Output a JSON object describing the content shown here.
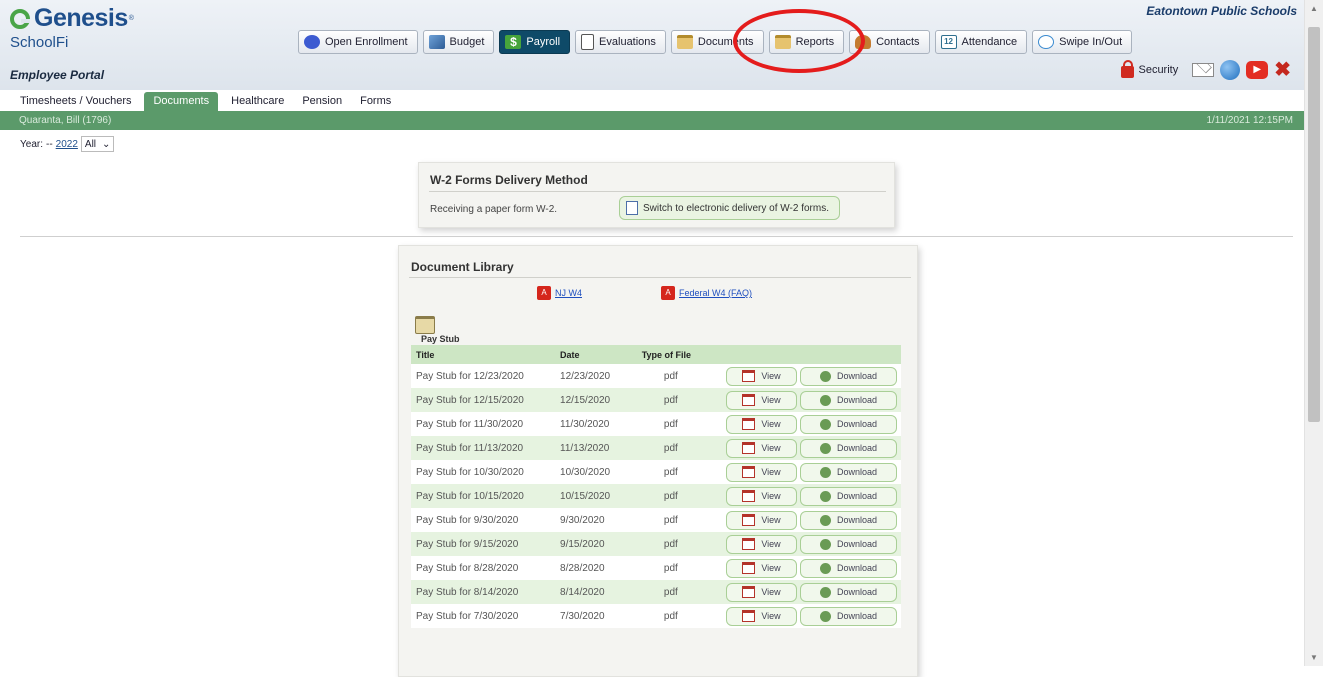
{
  "header": {
    "logo_word": "Genesis",
    "logo_reg": "®",
    "logo_sub": "SchoolFi",
    "portal_label": "Employee Portal",
    "school_name": "Eatontown Public Schools",
    "nav": [
      {
        "label": "Open Enrollment",
        "icon": "enrollment-icon"
      },
      {
        "label": "Budget",
        "icon": "budget-icon"
      },
      {
        "label": "Payroll",
        "icon": "payroll-icon",
        "active": true,
        "icon_glyph": "$"
      },
      {
        "label": "Evaluations",
        "icon": "evaluations-icon"
      },
      {
        "label": "Documents",
        "icon": "documents-folder-icon",
        "highlighted": true
      },
      {
        "label": "Reports",
        "icon": "reports-folder-icon"
      },
      {
        "label": "Contacts",
        "icon": "contacts-icon"
      },
      {
        "label": "Attendance",
        "icon": "attendance-calendar-icon",
        "icon_glyph": "12"
      },
      {
        "label": "Swipe In/Out",
        "icon": "swipe-clock-icon"
      }
    ],
    "utility": {
      "security_label": "Security",
      "icons": [
        "lock-icon",
        "mail-icon",
        "help-globe-icon",
        "video-icon",
        "close-icon"
      ]
    },
    "highlight_color": "#e41c1c"
  },
  "tabs": [
    {
      "label": "Timesheets / Vouchers"
    },
    {
      "label": "Documents",
      "active": true
    },
    {
      "label": "Healthcare"
    },
    {
      "label": "Pension"
    },
    {
      "label": "Forms"
    }
  ],
  "statusbar": {
    "employee": "Quaranta, Bill (1796)",
    "timestamp": "1/11/2021 12:15PM"
  },
  "filter": {
    "year_label": "Year:",
    "year_prefix": "--",
    "year_value": "2022",
    "select_value": "All",
    "select_arrow": "⌄"
  },
  "w2": {
    "title": "W-2 Forms Delivery Method",
    "status_text": "Receiving a paper form W-2.",
    "switch_button": "Switch to electronic delivery of W-2 forms."
  },
  "library": {
    "title": "Document Library",
    "links": [
      {
        "label": "NJ W4",
        "icon_glyph": "A"
      },
      {
        "label": "Federal W4 (FAQ)",
        "icon_glyph": "A"
      }
    ],
    "section_label": "Pay Stub",
    "columns": [
      "Title",
      "Date",
      "Type of File",
      ""
    ],
    "view_label": "View",
    "download_label": "Download",
    "rows": [
      {
        "title": "Pay Stub for 12/23/2020",
        "date": "12/23/2020",
        "type": "pdf"
      },
      {
        "title": "Pay Stub for 12/15/2020",
        "date": "12/15/2020",
        "type": "pdf"
      },
      {
        "title": "Pay Stub for 11/30/2020",
        "date": "11/30/2020",
        "type": "pdf"
      },
      {
        "title": "Pay Stub for 11/13/2020",
        "date": "11/13/2020",
        "type": "pdf"
      },
      {
        "title": "Pay Stub for 10/30/2020",
        "date": "10/30/2020",
        "type": "pdf"
      },
      {
        "title": "Pay Stub for 10/15/2020",
        "date": "10/15/2020",
        "type": "pdf"
      },
      {
        "title": "Pay Stub for 9/30/2020",
        "date": "9/30/2020",
        "type": "pdf"
      },
      {
        "title": "Pay Stub for 9/15/2020",
        "date": "9/15/2020",
        "type": "pdf"
      },
      {
        "title": "Pay Stub for 8/28/2020",
        "date": "8/28/2020",
        "type": "pdf"
      },
      {
        "title": "Pay Stub for 8/14/2020",
        "date": "8/14/2020",
        "type": "pdf"
      },
      {
        "title": "Pay Stub for 7/30/2020",
        "date": "7/30/2020",
        "type": "pdf"
      }
    ]
  },
  "scroll": {
    "up_glyph": "▲",
    "down_glyph": "▼"
  },
  "colors": {
    "accent_green": "#5b9a6a",
    "payroll_active": "#0e4a68",
    "brand_blue": "#1f4f8c"
  }
}
